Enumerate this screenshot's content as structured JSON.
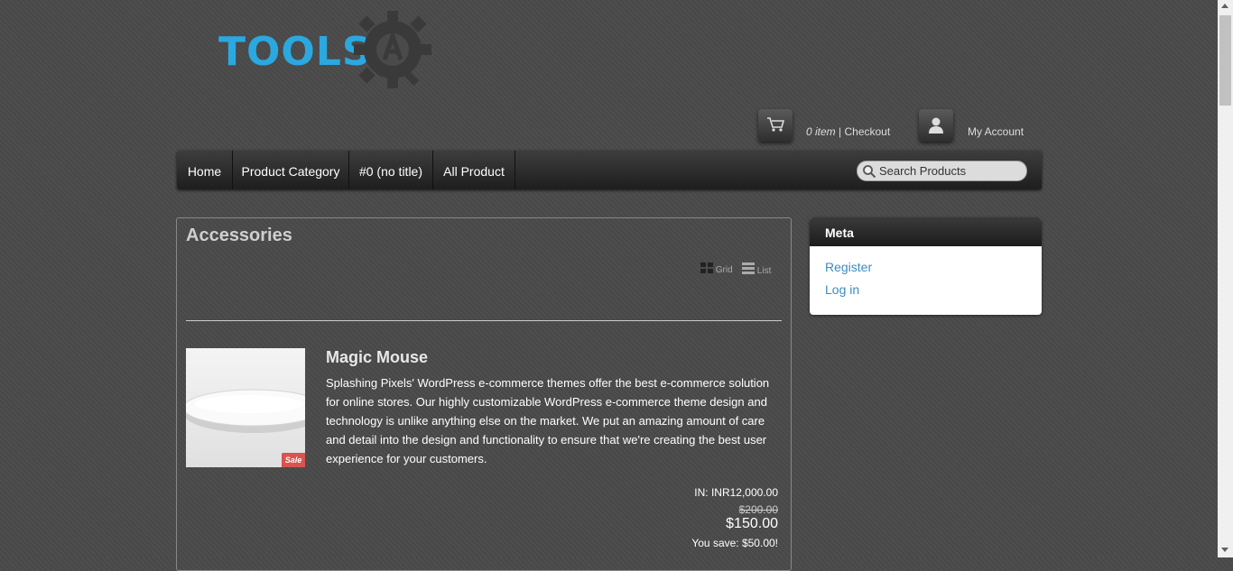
{
  "header": {
    "logo_text": "TOOLS",
    "cart": {
      "count": "0 item",
      "separator": " | ",
      "checkout": "Checkout"
    },
    "account": {
      "label": "My Account"
    }
  },
  "nav": {
    "items": [
      "Home",
      "Product Category",
      "#0 (no title)",
      "All Product"
    ],
    "search_placeholder": "Search Products"
  },
  "main": {
    "title": "Accessories",
    "view_options": {
      "grid": "Grid",
      "list": "List"
    },
    "product": {
      "name": "Magic Mouse",
      "badge": "Sale",
      "description": "Splashing Pixels' WordPress e-commerce themes offer the best e-commerce solution for online stores. Our highly customizable WordPress e-commerce theme design and technology is unlike anything else on the market. We put an amazing amount of care and detail into the design and functionality to ensure that we're creating the best user experience for your customers.",
      "price_in": "IN: INR12,000.00",
      "old_price": "$200.00",
      "new_price": "$150.00",
      "you_save": "You save: $50.00!"
    }
  },
  "sidebar": {
    "meta": {
      "title": "Meta",
      "links": [
        "Register",
        "Log in"
      ]
    }
  },
  "colors": {
    "logo": "#2ba8e0",
    "link": "#3a8cc4",
    "sale": "#d9534f",
    "background": "#4a4a4a"
  }
}
